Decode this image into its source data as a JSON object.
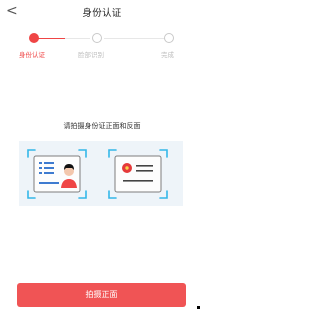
{
  "nav": {
    "back_icon": "chevron-left-icon",
    "back_glyph": "<",
    "title": "身份认证"
  },
  "steps": {
    "items": [
      {
        "label": "身份认证",
        "status": "active"
      },
      {
        "label": "脸部识别",
        "status": "pending"
      },
      {
        "label": "完成",
        "status": "pending"
      }
    ]
  },
  "instruction": "请拍摄身份证正面和反面",
  "illustration": {
    "front_icon": "id-card-front-icon",
    "back_icon": "id-card-back-icon"
  },
  "action": {
    "primary_label": "拍摄正面"
  },
  "colors": {
    "accent": "#f05455",
    "panel": "#eef4f9",
    "text": "#333333",
    "muted": "#bdbdbd"
  }
}
